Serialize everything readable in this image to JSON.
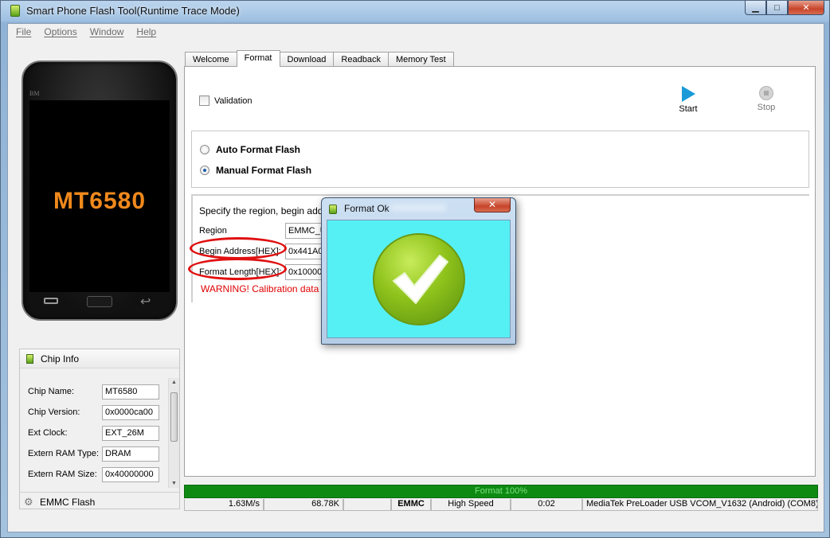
{
  "window": {
    "title": "Smart Phone Flash Tool(Runtime Trace Mode)",
    "controls": {
      "minimize": "▁",
      "maximize": "□",
      "close": "✕"
    }
  },
  "menu": [
    "File",
    "Options",
    "Window",
    "Help"
  ],
  "phone": {
    "brand": "BM",
    "model": "MT6580"
  },
  "chip_info": {
    "title": "Chip Info",
    "rows": [
      {
        "label": "Chip Name:",
        "value": "MT6580"
      },
      {
        "label": "Chip Version:",
        "value": "0x0000ca00"
      },
      {
        "label": "Ext Clock:",
        "value": "EXT_26M"
      },
      {
        "label": "Extern RAM Type:",
        "value": "DRAM"
      },
      {
        "label": "Extern RAM Size:",
        "value": "0x40000000"
      }
    ],
    "footer": "EMMC Flash"
  },
  "tabs": [
    "Welcome",
    "Format",
    "Download",
    "Readback",
    "Memory Test"
  ],
  "format_tab": {
    "validation_label": "Validation",
    "start_label": "Start",
    "stop_label": "Stop",
    "auto_label": "Auto Format Flash",
    "manual_label": "Manual Format Flash",
    "spec_text": "Specify the region, begin addres",
    "region_label": "Region",
    "region_value": "EMMC_U",
    "begin_label": "Begin Address[HEX]:",
    "begin_value": "0x441A0",
    "length_label": "Format Length[HEX]:",
    "length_value": "0x10000",
    "warning": "WARNING! Calibration data"
  },
  "status": {
    "progress_text": "Format 100%",
    "progress_fraction": 1.0,
    "cells": [
      "1.63M/s",
      "68.78K",
      "",
      "EMMC",
      "High Speed",
      "0:02",
      "MediaTek PreLoader USB VCOM_V1632 (Android) (COM8)"
    ]
  },
  "dialog": {
    "title": "Format Ok",
    "close": "✕"
  },
  "colors": {
    "progress": "#0e8a13",
    "dialog_body": "#55f0f4",
    "check_green": "#8ec21b",
    "warning": "#e00000",
    "highlight_ellipse": "#e01010"
  }
}
